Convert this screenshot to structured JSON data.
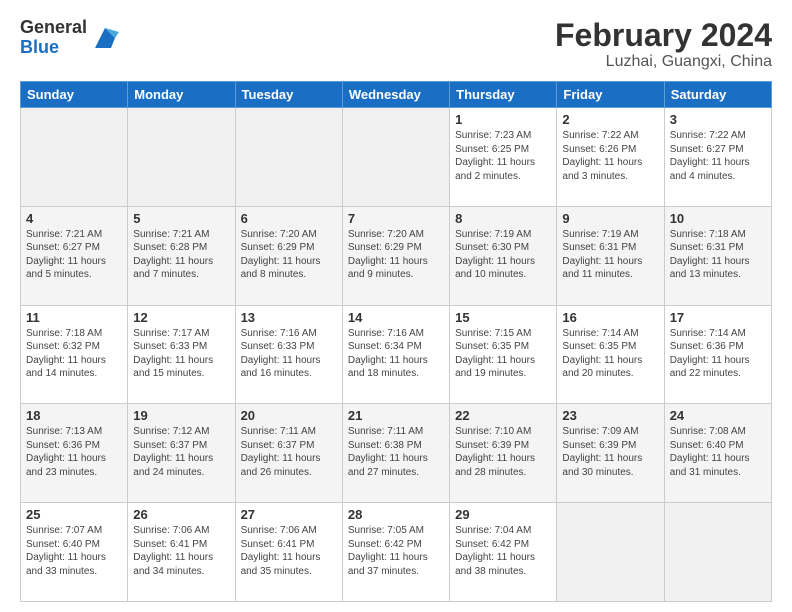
{
  "header": {
    "logo_general": "General",
    "logo_blue": "Blue",
    "month_year": "February 2024",
    "location": "Luzhai, Guangxi, China"
  },
  "weekdays": [
    "Sunday",
    "Monday",
    "Tuesday",
    "Wednesday",
    "Thursday",
    "Friday",
    "Saturday"
  ],
  "weeks": [
    [
      {
        "day": "",
        "info": ""
      },
      {
        "day": "",
        "info": ""
      },
      {
        "day": "",
        "info": ""
      },
      {
        "day": "",
        "info": ""
      },
      {
        "day": "1",
        "info": "Sunrise: 7:23 AM\nSunset: 6:25 PM\nDaylight: 11 hours\nand 2 minutes."
      },
      {
        "day": "2",
        "info": "Sunrise: 7:22 AM\nSunset: 6:26 PM\nDaylight: 11 hours\nand 3 minutes."
      },
      {
        "day": "3",
        "info": "Sunrise: 7:22 AM\nSunset: 6:27 PM\nDaylight: 11 hours\nand 4 minutes."
      }
    ],
    [
      {
        "day": "4",
        "info": "Sunrise: 7:21 AM\nSunset: 6:27 PM\nDaylight: 11 hours\nand 5 minutes."
      },
      {
        "day": "5",
        "info": "Sunrise: 7:21 AM\nSunset: 6:28 PM\nDaylight: 11 hours\nand 7 minutes."
      },
      {
        "day": "6",
        "info": "Sunrise: 7:20 AM\nSunset: 6:29 PM\nDaylight: 11 hours\nand 8 minutes."
      },
      {
        "day": "7",
        "info": "Sunrise: 7:20 AM\nSunset: 6:29 PM\nDaylight: 11 hours\nand 9 minutes."
      },
      {
        "day": "8",
        "info": "Sunrise: 7:19 AM\nSunset: 6:30 PM\nDaylight: 11 hours\nand 10 minutes."
      },
      {
        "day": "9",
        "info": "Sunrise: 7:19 AM\nSunset: 6:31 PM\nDaylight: 11 hours\nand 11 minutes."
      },
      {
        "day": "10",
        "info": "Sunrise: 7:18 AM\nSunset: 6:31 PM\nDaylight: 11 hours\nand 13 minutes."
      }
    ],
    [
      {
        "day": "11",
        "info": "Sunrise: 7:18 AM\nSunset: 6:32 PM\nDaylight: 11 hours\nand 14 minutes."
      },
      {
        "day": "12",
        "info": "Sunrise: 7:17 AM\nSunset: 6:33 PM\nDaylight: 11 hours\nand 15 minutes."
      },
      {
        "day": "13",
        "info": "Sunrise: 7:16 AM\nSunset: 6:33 PM\nDaylight: 11 hours\nand 16 minutes."
      },
      {
        "day": "14",
        "info": "Sunrise: 7:16 AM\nSunset: 6:34 PM\nDaylight: 11 hours\nand 18 minutes."
      },
      {
        "day": "15",
        "info": "Sunrise: 7:15 AM\nSunset: 6:35 PM\nDaylight: 11 hours\nand 19 minutes."
      },
      {
        "day": "16",
        "info": "Sunrise: 7:14 AM\nSunset: 6:35 PM\nDaylight: 11 hours\nand 20 minutes."
      },
      {
        "day": "17",
        "info": "Sunrise: 7:14 AM\nSunset: 6:36 PM\nDaylight: 11 hours\nand 22 minutes."
      }
    ],
    [
      {
        "day": "18",
        "info": "Sunrise: 7:13 AM\nSunset: 6:36 PM\nDaylight: 11 hours\nand 23 minutes."
      },
      {
        "day": "19",
        "info": "Sunrise: 7:12 AM\nSunset: 6:37 PM\nDaylight: 11 hours\nand 24 minutes."
      },
      {
        "day": "20",
        "info": "Sunrise: 7:11 AM\nSunset: 6:37 PM\nDaylight: 11 hours\nand 26 minutes."
      },
      {
        "day": "21",
        "info": "Sunrise: 7:11 AM\nSunset: 6:38 PM\nDaylight: 11 hours\nand 27 minutes."
      },
      {
        "day": "22",
        "info": "Sunrise: 7:10 AM\nSunset: 6:39 PM\nDaylight: 11 hours\nand 28 minutes."
      },
      {
        "day": "23",
        "info": "Sunrise: 7:09 AM\nSunset: 6:39 PM\nDaylight: 11 hours\nand 30 minutes."
      },
      {
        "day": "24",
        "info": "Sunrise: 7:08 AM\nSunset: 6:40 PM\nDaylight: 11 hours\nand 31 minutes."
      }
    ],
    [
      {
        "day": "25",
        "info": "Sunrise: 7:07 AM\nSunset: 6:40 PM\nDaylight: 11 hours\nand 33 minutes."
      },
      {
        "day": "26",
        "info": "Sunrise: 7:06 AM\nSunset: 6:41 PM\nDaylight: 11 hours\nand 34 minutes."
      },
      {
        "day": "27",
        "info": "Sunrise: 7:06 AM\nSunset: 6:41 PM\nDaylight: 11 hours\nand 35 minutes."
      },
      {
        "day": "28",
        "info": "Sunrise: 7:05 AM\nSunset: 6:42 PM\nDaylight: 11 hours\nand 37 minutes."
      },
      {
        "day": "29",
        "info": "Sunrise: 7:04 AM\nSunset: 6:42 PM\nDaylight: 11 hours\nand 38 minutes."
      },
      {
        "day": "",
        "info": ""
      },
      {
        "day": "",
        "info": ""
      }
    ]
  ]
}
